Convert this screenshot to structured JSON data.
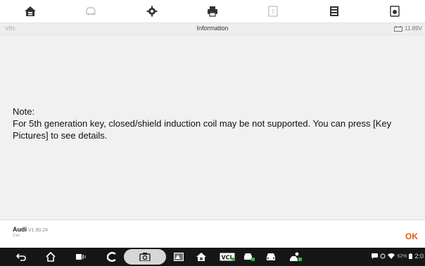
{
  "toolbar": {
    "items": [
      {
        "icon": "home-icon"
      },
      {
        "icon": "vehicle-swap-icon"
      },
      {
        "icon": "settings-icon"
      },
      {
        "icon": "print-icon"
      },
      {
        "icon": "help-icon"
      },
      {
        "icon": "save-icon"
      },
      {
        "icon": "screenshot-icon"
      }
    ]
  },
  "infobar": {
    "vin_label": "VIN:",
    "title": "Information",
    "voltage": "11.89V"
  },
  "message": {
    "label": "Note:",
    "text": "For 5th generation key, closed/shield induction coil may be not supported. You can press [Key Pictures] to see details."
  },
  "footer": {
    "brand": "Audi",
    "version": "V1.90.24",
    "car_label": "Car:",
    "ok_label": "OK"
  },
  "system_bar": {
    "battery_text": "62%",
    "clock": "2:0"
  }
}
